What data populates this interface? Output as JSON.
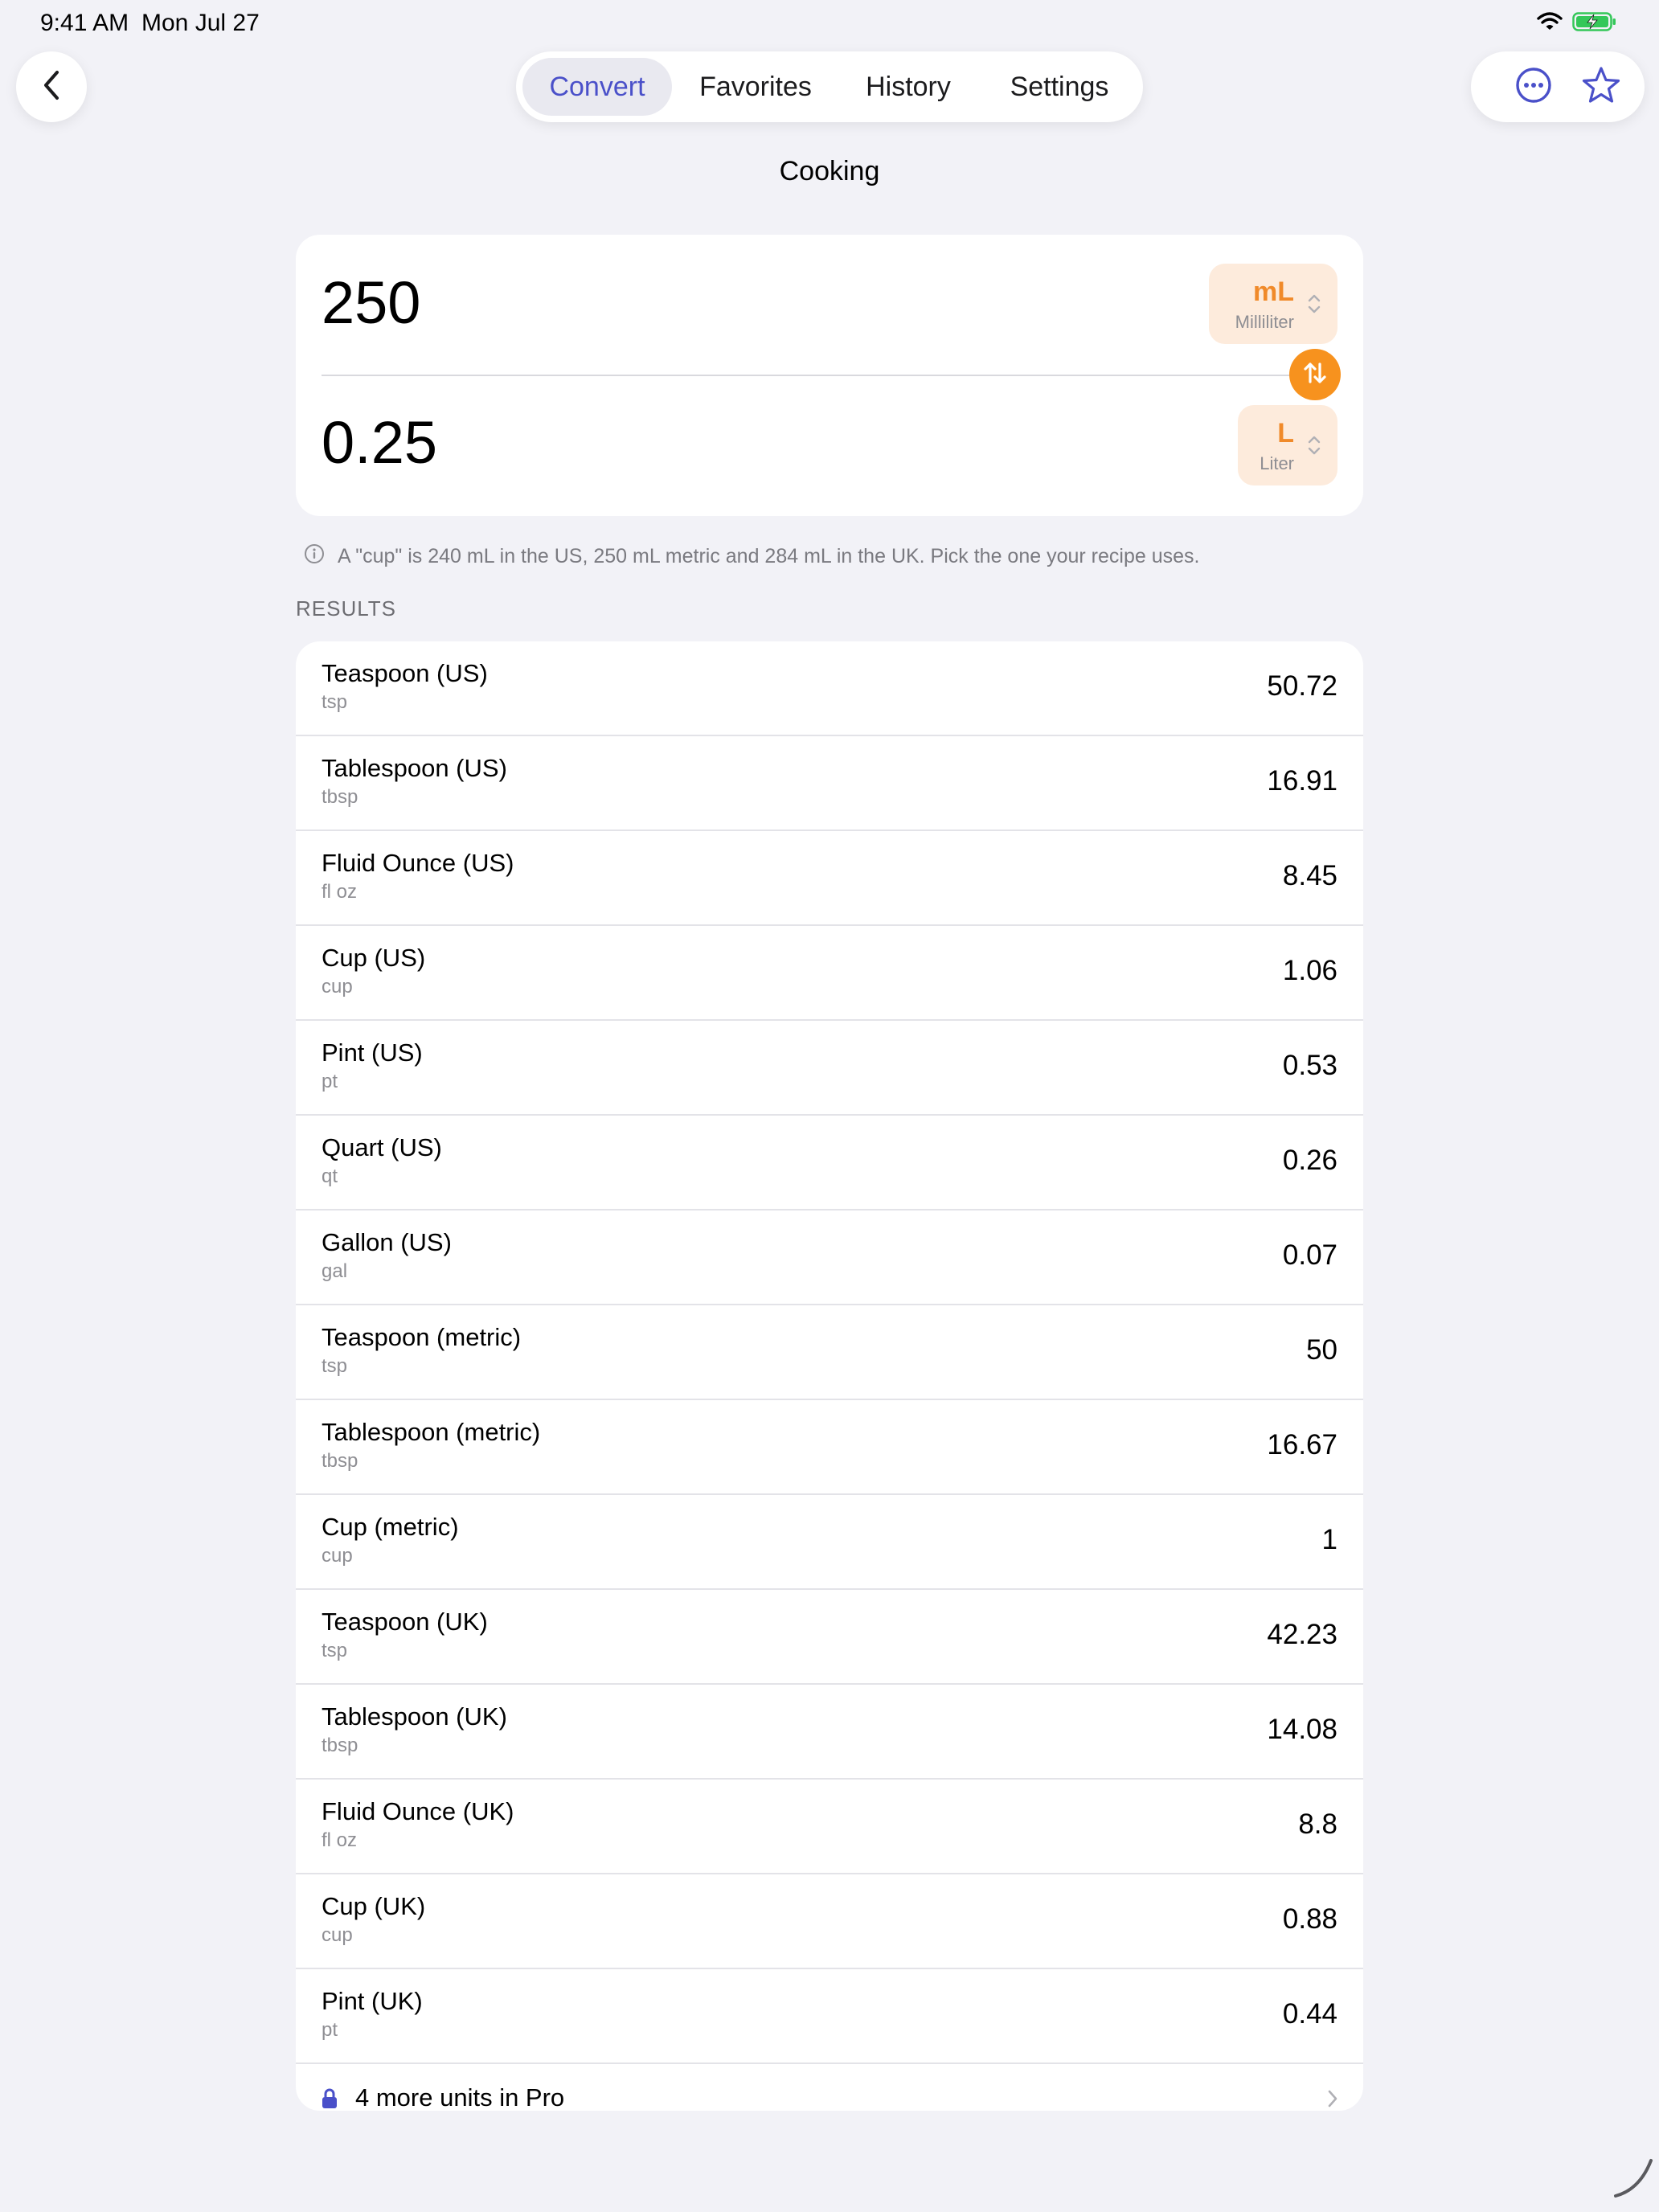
{
  "status_bar": {
    "time": "9:41 AM",
    "date": "Mon Jul 27"
  },
  "nav": {
    "tabs": [
      {
        "label": "Convert",
        "active": true
      },
      {
        "label": "Favorites",
        "active": false
      },
      {
        "label": "History",
        "active": false
      },
      {
        "label": "Settings",
        "active": false
      }
    ],
    "icons": {
      "back": "chevron-left-icon",
      "more": "ellipsis-circle-icon",
      "favorite": "star-icon"
    }
  },
  "page": {
    "title": "Cooking"
  },
  "converter": {
    "from_value": "250",
    "from_unit_abbr": "mL",
    "from_unit_name": "Milliliter",
    "to_value": "0.25",
    "to_unit_abbr": "L",
    "to_unit_name": "Liter"
  },
  "info_note": "A \"cup\" is 240 mL in the US, 250 mL metric and 284 mL in the UK. Pick the one your recipe uses.",
  "results": {
    "header": "RESULTS",
    "rows": [
      {
        "name": "Teaspoon (US)",
        "abbr": "tsp",
        "value": "50.72"
      },
      {
        "name": "Tablespoon (US)",
        "abbr": "tbsp",
        "value": "16.91"
      },
      {
        "name": "Fluid Ounce (US)",
        "abbr": "fl oz",
        "value": "8.45"
      },
      {
        "name": "Cup (US)",
        "abbr": "cup",
        "value": "1.06"
      },
      {
        "name": "Pint (US)",
        "abbr": "pt",
        "value": "0.53"
      },
      {
        "name": "Quart (US)",
        "abbr": "qt",
        "value": "0.26"
      },
      {
        "name": "Gallon (US)",
        "abbr": "gal",
        "value": "0.07"
      },
      {
        "name": "Teaspoon (metric)",
        "abbr": "tsp",
        "value": "50"
      },
      {
        "name": "Tablespoon (metric)",
        "abbr": "tbsp",
        "value": "16.67"
      },
      {
        "name": "Cup (metric)",
        "abbr": "cup",
        "value": "1"
      },
      {
        "name": "Teaspoon (UK)",
        "abbr": "tsp",
        "value": "42.23"
      },
      {
        "name": "Tablespoon (UK)",
        "abbr": "tbsp",
        "value": "14.08"
      },
      {
        "name": "Fluid Ounce (UK)",
        "abbr": "fl oz",
        "value": "8.8"
      },
      {
        "name": "Cup (UK)",
        "abbr": "cup",
        "value": "0.88"
      },
      {
        "name": "Pint (UK)",
        "abbr": "pt",
        "value": "0.44"
      }
    ],
    "pro_label": "4 more units in Pro"
  },
  "colors": {
    "accent": "#4A50C9",
    "orange": "#F08A2A",
    "swap_orange": "#F7921E",
    "unit_bg": "#FDEBDC",
    "background": "#F2F2F7"
  }
}
